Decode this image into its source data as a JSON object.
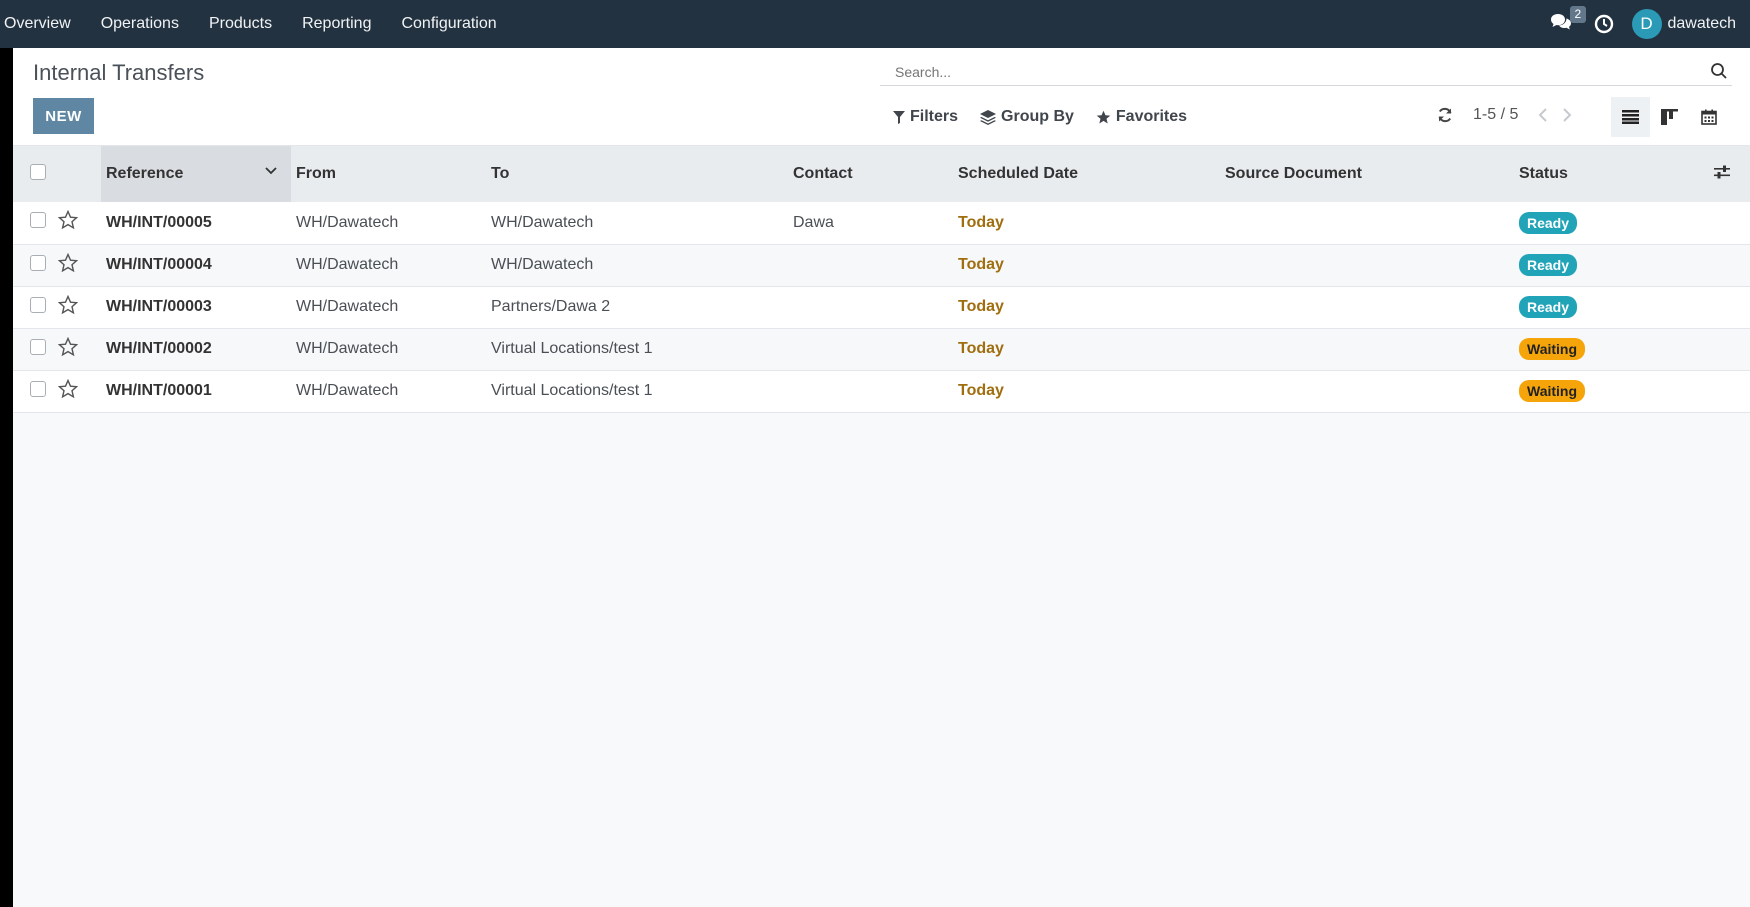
{
  "nav": {
    "items": [
      "Overview",
      "Operations",
      "Products",
      "Reporting",
      "Configuration"
    ],
    "chat_count": "2",
    "avatar_letter": "D",
    "user_name": "dawatech"
  },
  "control": {
    "title": "Internal Transfers",
    "new_label": "NEW",
    "search_placeholder": "Search...",
    "filters_label": "Filters",
    "groupby_label": "Group By",
    "favorites_label": "Favorites",
    "pager": "1-5 / 5"
  },
  "table": {
    "columns": [
      "Reference",
      "From",
      "To",
      "Contact",
      "Scheduled Date",
      "Source Document",
      "Status"
    ],
    "rows": [
      {
        "reference": "WH/INT/00005",
        "from": "WH/Dawatech",
        "to": "WH/Dawatech",
        "contact": "Dawa",
        "date": "Today",
        "source": "",
        "status": "Ready"
      },
      {
        "reference": "WH/INT/00004",
        "from": "WH/Dawatech",
        "to": "WH/Dawatech",
        "contact": "",
        "date": "Today",
        "source": "",
        "status": "Ready"
      },
      {
        "reference": "WH/INT/00003",
        "from": "WH/Dawatech",
        "to": "Partners/Dawa 2",
        "contact": "",
        "date": "Today",
        "source": "",
        "status": "Ready"
      },
      {
        "reference": "WH/INT/00002",
        "from": "WH/Dawatech",
        "to": "Virtual Locations/test 1",
        "contact": "",
        "date": "Today",
        "source": "",
        "status": "Waiting"
      },
      {
        "reference": "WH/INT/00001",
        "from": "WH/Dawatech",
        "to": "Virtual Locations/test 1",
        "contact": "",
        "date": "Today",
        "source": "",
        "status": "Waiting"
      }
    ]
  },
  "colors": {
    "navbar": "#233240",
    "primary_button": "#5f86a2",
    "ready": "#21a3b8",
    "waiting": "#f5a50a",
    "date_text": "#a06e0f"
  }
}
